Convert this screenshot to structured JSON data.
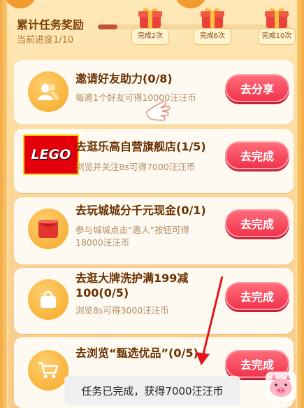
{
  "header": {
    "title": "累计任务奖励",
    "progress_text": "当前进度1/10",
    "progress_fraction": 0.1,
    "milestones": [
      {
        "label": "完成2次",
        "icon": "gift-box-icon"
      },
      {
        "label": "完成6次",
        "icon": "gift-box-icon"
      },
      {
        "label": "完成10次",
        "icon": "gift-box-icon"
      }
    ]
  },
  "tasks": [
    {
      "title": "邀请好友助力(0/8)",
      "desc": "每邀1个好友可得10000汪汪币",
      "button": "去分享",
      "icon": "friends-icon"
    },
    {
      "title": "去逛乐高自营旗舰店(1/5)",
      "desc": "浏览并关注8s可得7000汪汪币",
      "button": "去完成",
      "icon": "lego-logo",
      "logo_text": "LEGO"
    },
    {
      "title": "去玩城城分千元现金(0/1)",
      "desc": "参与城城点击“邀人”按钮可得18000汪汪币",
      "button": "去完成",
      "icon": "red-envelope-icon"
    },
    {
      "title": "去逛大牌洗护满199减100(0/5)",
      "desc": "浏览8s可得3000汪汪币",
      "button": "去完成",
      "icon": "shopping-bag-icon"
    },
    {
      "title": "去浏览“甄选优品”(0/5)",
      "desc": "",
      "button": "去完成",
      "icon": "shopping-cart-icon"
    }
  ],
  "toast": {
    "text": "任务已完成，获得7000汪汪币"
  },
  "colors": {
    "accent": "#f0344c",
    "card_bg": "#fffaf1",
    "title": "#6b3100"
  }
}
